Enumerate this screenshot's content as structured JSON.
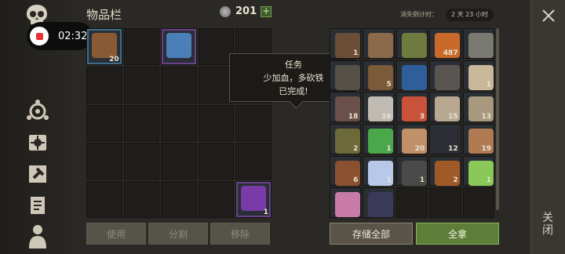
{
  "header": {
    "title": "物品栏",
    "coins": "201",
    "plus": "+",
    "expire_label": "消失倒计时：",
    "expire_value": "2 天 23 小时"
  },
  "recorder": {
    "time": "02:32"
  },
  "tooltip": {
    "line1": "任务",
    "line2": "少加血，多砍铁",
    "line3": "已完成!"
  },
  "left_grid": {
    "cells": [
      {
        "item": "leather-flask",
        "qty": "20",
        "frame": "blue"
      },
      {
        "item": "",
        "qty": ""
      },
      {
        "item": "glowing-halberd",
        "qty": "",
        "frame": "purple"
      },
      {
        "item": "",
        "qty": ""
      },
      {
        "item": "",
        "qty": ""
      },
      {
        "item": "",
        "qty": ""
      },
      {
        "item": "",
        "qty": ""
      },
      {
        "item": "",
        "qty": ""
      },
      {
        "item": "",
        "qty": ""
      },
      {
        "item": "",
        "qty": ""
      },
      {
        "item": "",
        "qty": ""
      },
      {
        "item": "",
        "qty": ""
      },
      {
        "item": "",
        "qty": ""
      },
      {
        "item": "",
        "qty": ""
      },
      {
        "item": "",
        "qty": ""
      },
      {
        "item": "",
        "qty": ""
      },
      {
        "item": "",
        "qty": ""
      },
      {
        "item": "",
        "qty": ""
      },
      {
        "item": "",
        "qty": ""
      },
      {
        "item": "",
        "qty": ""
      },
      {
        "item": "",
        "qty": ""
      },
      {
        "item": "",
        "qty": ""
      },
      {
        "item": "",
        "qty": ""
      },
      {
        "item": "",
        "qty": ""
      },
      {
        "item": "purple-potion",
        "qty": "1",
        "frame": "purple"
      }
    ]
  },
  "right_grid": {
    "cells": [
      {
        "item": "crossbow",
        "qty": "1"
      },
      {
        "item": "axe",
        "qty": ""
      },
      {
        "item": "creature-head",
        "qty": ""
      },
      {
        "item": "orange-ore",
        "qty": "487"
      },
      {
        "item": "spear",
        "qty": ""
      },
      {
        "item": "pickaxe",
        "qty": ""
      },
      {
        "item": "leather-scrap",
        "qty": "5"
      },
      {
        "item": "blue-book",
        "qty": ""
      },
      {
        "item": "armor-gloves",
        "qty": ""
      },
      {
        "item": "clown-map",
        "qty": "1"
      },
      {
        "item": "iron-rod",
        "qty": "18"
      },
      {
        "item": "salt-pile",
        "qty": "16"
      },
      {
        "item": "raw-meat",
        "qty": "3"
      },
      {
        "item": "mushrooms",
        "qty": "15"
      },
      {
        "item": "log",
        "qty": "13"
      },
      {
        "item": "seed-ball",
        "qty": "2"
      },
      {
        "item": "green-potion",
        "qty": "1"
      },
      {
        "item": "wood-chips",
        "qty": "20"
      },
      {
        "item": "dark-berries",
        "qty": "12"
      },
      {
        "item": "hide",
        "qty": "19"
      },
      {
        "item": "leather",
        "qty": "6"
      },
      {
        "item": "vial",
        "qty": "1"
      },
      {
        "item": "iron-bar",
        "qty": "1"
      },
      {
        "item": "stew-bowl",
        "qty": "2"
      },
      {
        "item": "green-flask",
        "qty": "1"
      },
      {
        "item": "pink-potion",
        "qty": ""
      },
      {
        "item": "dark-orb",
        "qty": ""
      },
      {
        "item": "",
        "qty": ""
      },
      {
        "item": "",
        "qty": ""
      },
      {
        "item": "",
        "qty": ""
      }
    ]
  },
  "buttons": {
    "use": "使用",
    "split": "分割",
    "remove": "移除",
    "store_all": "存储全部",
    "take_all": "全拿"
  },
  "close": {
    "label": "关闭"
  },
  "colors": {
    "accent_green": "#5c7e38",
    "frame_blue": "#3b6f8e",
    "frame_purple": "#6a3f8c"
  }
}
